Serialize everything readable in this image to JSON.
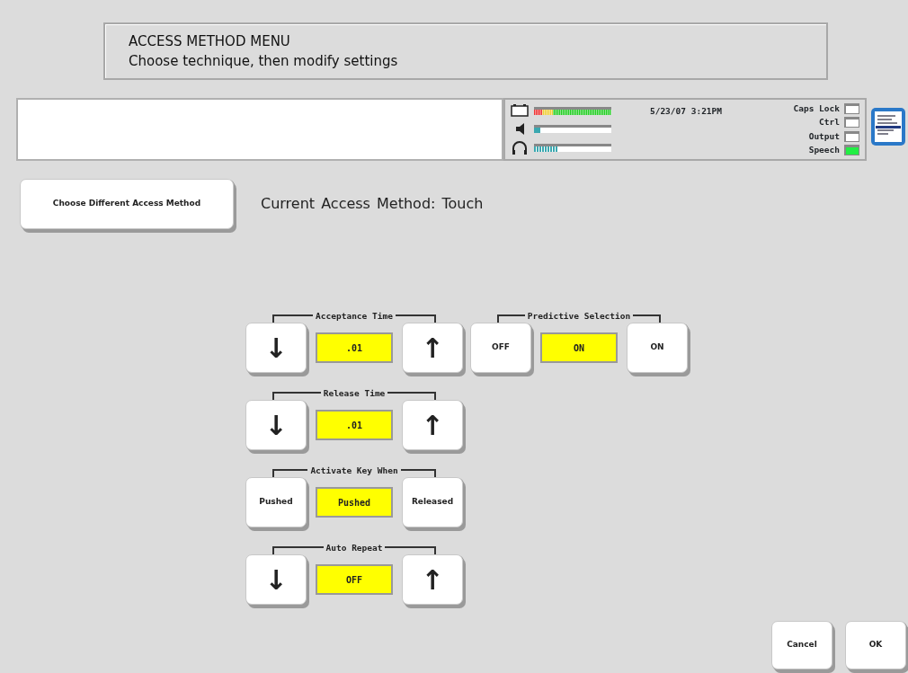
{
  "header": {
    "title": "ACCESS METHOD MENU",
    "subtitle": "Choose technique, then modify settings"
  },
  "status": {
    "meters": [
      {
        "kind": "battery",
        "level": 1.0
      },
      {
        "kind": "speaker",
        "level": 0.08
      },
      {
        "kind": "headphones",
        "level": 0.3
      }
    ],
    "datetime": "5/23/07 3:21PM",
    "indicators": [
      {
        "label": "Caps Lock",
        "on": false
      },
      {
        "label": "Ctrl",
        "on": false
      },
      {
        "label": "Output",
        "on": false
      },
      {
        "label": "Speech",
        "on": true
      }
    ]
  },
  "access_button": "Choose Different Access Method",
  "current_method": {
    "label": "Current Access Method:",
    "value": "Touch"
  },
  "columns": [
    [
      {
        "kind": "stepper",
        "label": "Acceptance Time",
        "left": "↓",
        "value": ".01",
        "right": "↑"
      },
      {
        "kind": "stepper",
        "label": "Release Time",
        "left": "↓",
        "value": ".01",
        "right": "↑"
      },
      {
        "kind": "choice",
        "label": "Activate Key When",
        "left": "Pushed",
        "value": "Pushed",
        "right": "Released"
      },
      {
        "kind": "stepper",
        "label": "Auto Repeat",
        "left": "↓",
        "value": "OFF",
        "right": "↑"
      }
    ],
    [
      {
        "kind": "choice",
        "label": "Predictive Selection",
        "left": "OFF",
        "value": "ON",
        "right": "ON"
      }
    ]
  ],
  "buttons": [
    "Cancel",
    "OK"
  ]
}
